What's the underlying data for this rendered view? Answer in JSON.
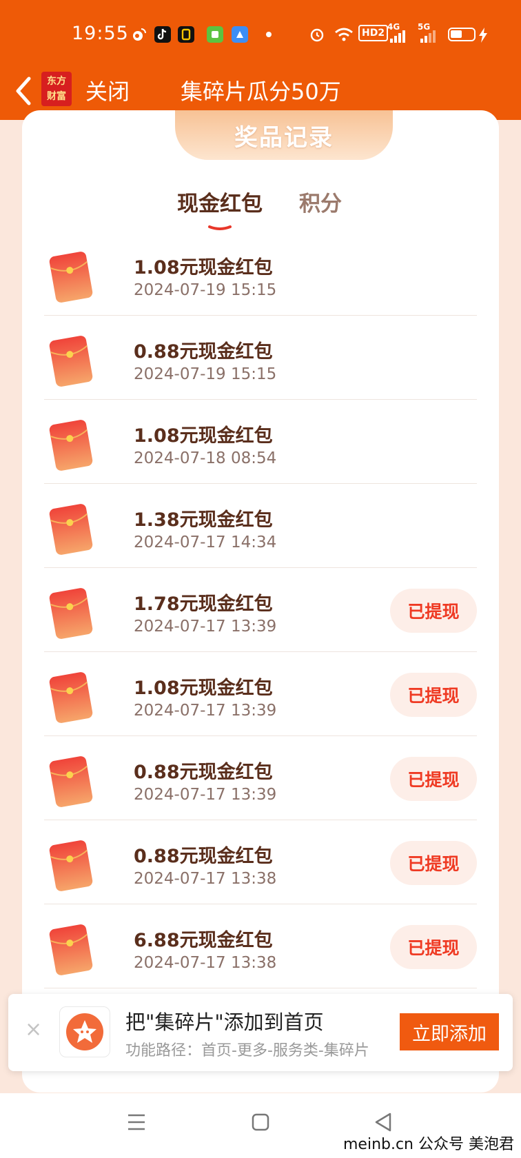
{
  "status_bar": {
    "time": "19:55",
    "network_label_1": "HD2",
    "network_label_2": "4G",
    "network_label_3": "5G"
  },
  "nav": {
    "logo_line1": "东方",
    "logo_line2": "财富",
    "close_label": "关闭",
    "title": "集碎片瓜分50万"
  },
  "card": {
    "header": "奖品记录",
    "tabs": [
      {
        "label": "现金红包",
        "active": true
      },
      {
        "label": "积分",
        "active": false
      }
    ]
  },
  "records": [
    {
      "amount": "1.08元现金红包",
      "date": "2024-07-19 15:15",
      "status": ""
    },
    {
      "amount": "0.88元现金红包",
      "date": "2024-07-19 15:15",
      "status": ""
    },
    {
      "amount": "1.08元现金红包",
      "date": "2024-07-18 08:54",
      "status": ""
    },
    {
      "amount": "1.38元现金红包",
      "date": "2024-07-17 14:34",
      "status": ""
    },
    {
      "amount": "1.78元现金红包",
      "date": "2024-07-17 13:39",
      "status": "已提现"
    },
    {
      "amount": "1.08元现金红包",
      "date": "2024-07-17 13:39",
      "status": "已提现"
    },
    {
      "amount": "0.88元现金红包",
      "date": "2024-07-17 13:39",
      "status": "已提现"
    },
    {
      "amount": "0.88元现金红包",
      "date": "2024-07-17 13:38",
      "status": "已提现"
    },
    {
      "amount": "6.88元现金红包",
      "date": "2024-07-17 13:38",
      "status": "已提现"
    }
  ],
  "banner": {
    "close_glyph": "×",
    "title": "把\"集碎片\"添加到首页",
    "path": "功能路径：首页-更多-服务类-集碎片",
    "button": "立即添加"
  },
  "watermark": "meinb.cn  公众号 美泡君",
  "colors": {
    "brand_orange": "#ee5a07",
    "withdraw_text": "#ef3a23",
    "amount_text": "#5a2e1c"
  }
}
